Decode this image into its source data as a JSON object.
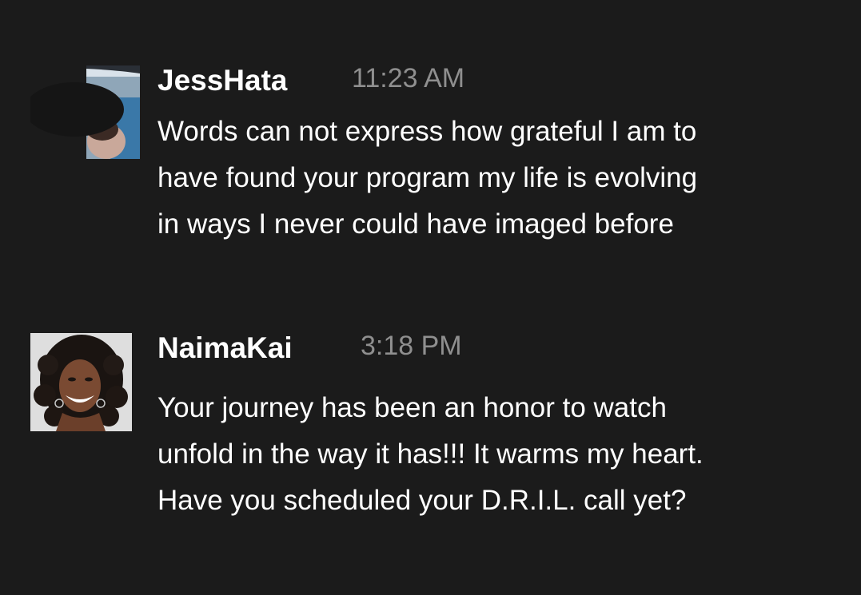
{
  "messages": [
    {
      "username": "JessHata",
      "timestamp": "11:23 AM",
      "lines": [
        "Words can not express how grateful I am to",
        "have found your program my life is evolving",
        "in ways I never could have imaged before"
      ],
      "avatar": "avatar-photo-redacted"
    },
    {
      "username": "NaimaKai",
      "timestamp": "3:18 PM",
      "lines": [
        "Your journey has been an honor to watch",
        "unfold in the way it has!!! It warms my heart.",
        "Have you scheduled your D.R.I.L. call yet?"
      ],
      "avatar": "avatar-photo-woman-curly-hair"
    }
  ],
  "colors": {
    "background": "#1b1b1b",
    "text": "#ffffff",
    "timestamp": "#8f8f8f"
  }
}
